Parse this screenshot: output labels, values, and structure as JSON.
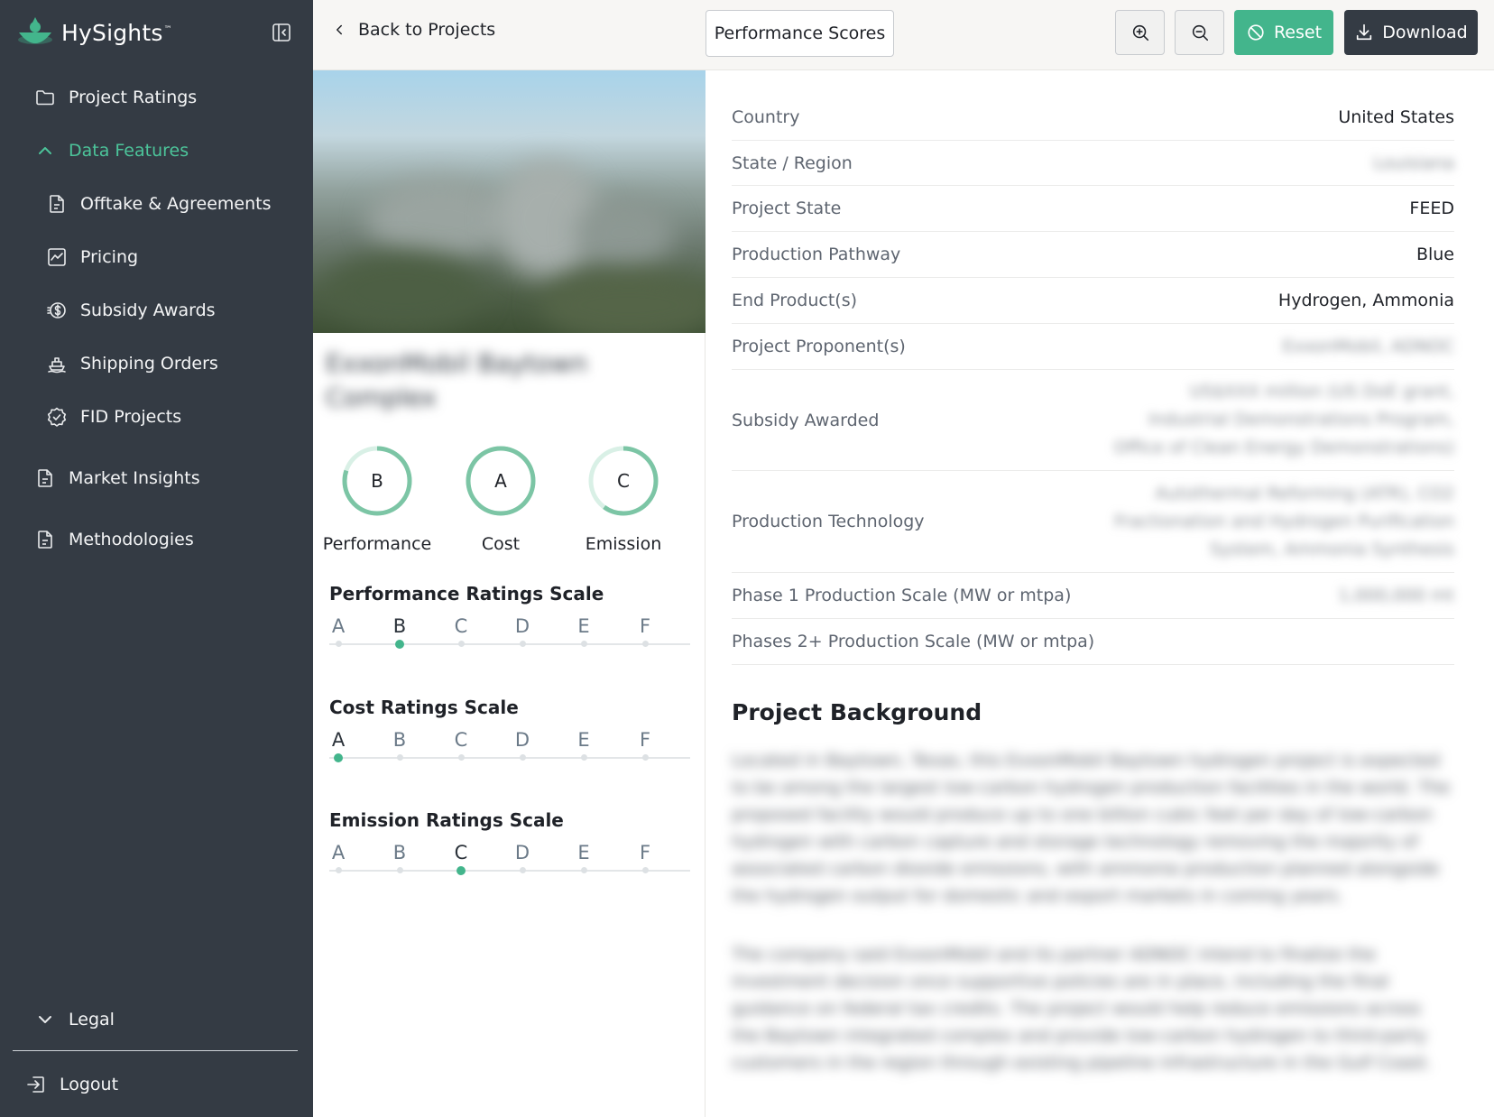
{
  "app": {
    "brand_name": "HySights",
    "brand_tm": "™",
    "accent_color": "#43b58c",
    "sidebar_color": "#343b44"
  },
  "sidebar": {
    "items": [
      {
        "label": "Project Ratings",
        "icon": "folder-icon"
      },
      {
        "label": "Data Features",
        "icon": "chevron-up-icon",
        "active": true
      },
      {
        "label": "Offtake & Agreements",
        "icon": "document-icon"
      },
      {
        "label": "Pricing",
        "icon": "line-chart-icon"
      },
      {
        "label": "Subsidy Awards",
        "icon": "dollar-coin-icon"
      },
      {
        "label": "Shipping Orders",
        "icon": "ship-icon"
      },
      {
        "label": "FID Projects",
        "icon": "check-badge-icon"
      },
      {
        "label": "Market Insights",
        "icon": "document-icon"
      },
      {
        "label": "Methodologies",
        "icon": "document-icon"
      }
    ],
    "legal_label": "Legal",
    "logout_label": "Logout"
  },
  "topbar": {
    "back_label": "Back to Projects",
    "view_label": "Performance Scores",
    "reset_label": "Reset",
    "download_label": "Download"
  },
  "project": {
    "name": "ExxonMobil Baytown Complex",
    "grades": [
      {
        "letter": "B",
        "label": "Performance",
        "level": 0.8
      },
      {
        "letter": "A",
        "label": "Cost",
        "level": 1.0
      },
      {
        "letter": "C",
        "label": "Emission",
        "level": 0.6
      }
    ],
    "scales": [
      {
        "title": "Performance Ratings Scale",
        "steps": [
          "A",
          "B",
          "C",
          "D",
          "E",
          "F"
        ],
        "selected": "B"
      },
      {
        "title": "Cost Ratings Scale",
        "steps": [
          "A",
          "B",
          "C",
          "D",
          "E",
          "F"
        ],
        "selected": "A"
      },
      {
        "title": "Emission Ratings Scale",
        "steps": [
          "A",
          "B",
          "C",
          "D",
          "E",
          "F"
        ],
        "selected": "C"
      }
    ]
  },
  "details": [
    {
      "label": "Country",
      "value": "United States"
    },
    {
      "label": "State / Region",
      "value": "Louisiana"
    },
    {
      "label": "Project State",
      "value": "FEED"
    },
    {
      "label": "Production Pathway",
      "value": "Blue"
    },
    {
      "label": "End Product(s)",
      "value": "Hydrogen, Ammonia"
    },
    {
      "label": "Project Proponent(s)",
      "value": "ExxonMobil, ADNOC"
    },
    {
      "label": "Subsidy Awarded",
      "value": "US$XXX million (US DoE grant, Industrial Demonstrations Program, Office of Clean Energy Demonstrations)"
    },
    {
      "label": "Production Technology",
      "value": "Autothermal Reforming (ATR), CO2 Fractionation and Hydrogen Purification System, Ammonia Synthesis"
    },
    {
      "label": "Phase 1 Production Scale (MW or mtpa)",
      "value": "1,000,000 mt"
    },
    {
      "label": "Phases 2+ Production Scale (MW or mtpa)",
      "value": ""
    }
  ],
  "background": {
    "title": "Project Background",
    "paragraphs": [
      "Located in Baytown, Texas, this ExxonMobil Baytown hydrogen project is expected to be among the largest low-carbon hydrogen production facilities in the world. The proposed facility would produce up to one billion cubic feet per day of low-carbon hydrogen with carbon capture and storage technology removing the majority of associated carbon dioxide emissions, with ammonia production planned alongside the hydrogen output for domestic and export markets in coming years.",
      "The company said ExxonMobil and its partner ADNOC intend to finalize the investment decision once supportive policies are in place, including the final guidance on federal tax credits. The project would help reduce emissions across the Baytown integrated complex and provide low-carbon hydrogen to third-party customers in the region through existing pipeline infrastructure in the Gulf Coast."
    ]
  }
}
